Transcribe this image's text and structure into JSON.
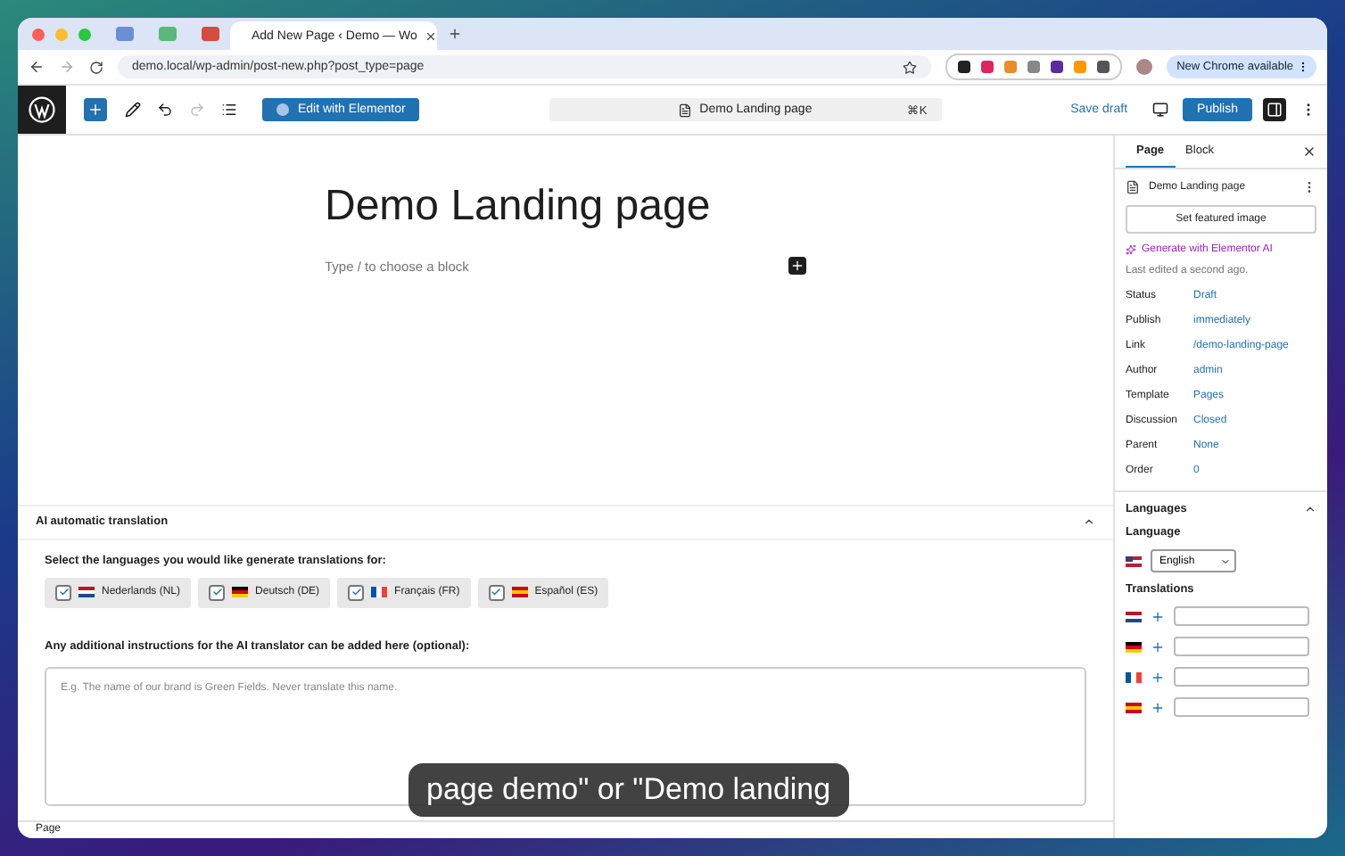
{
  "browser": {
    "tab_title": "Add New Page ‹ Demo — Wo",
    "url": "demo.local/wp-admin/post-new.php?post_type=page",
    "update_button": "New Chrome available"
  },
  "toolbar": {
    "elementor_button": "Edit with Elementor",
    "command_title": "Demo Landing page",
    "shortcut": "⌘K",
    "save_draft": "Save draft",
    "publish": "Publish"
  },
  "editor": {
    "title": "Demo Landing page",
    "placeholder": "Type / to choose a block"
  },
  "sidebar": {
    "tabs": [
      {
        "label": "Page",
        "selected": true
      },
      {
        "label": "Block",
        "selected": false
      }
    ],
    "page_title": "Demo Landing page",
    "featured_button": "Set featured image",
    "ai_link": "Generate with Elementor AI",
    "last_edited": "Last edited a second ago.",
    "fields": [
      {
        "label": "Status",
        "value": "Draft"
      },
      {
        "label": "Publish",
        "value": "immediately"
      },
      {
        "label": "Link",
        "value": "/demo-landing-page"
      },
      {
        "label": "Author",
        "value": "admin"
      },
      {
        "label": "Template",
        "value": "Pages"
      },
      {
        "label": "Discussion",
        "value": "Closed"
      },
      {
        "label": "Parent",
        "value": "None"
      },
      {
        "label": "Order",
        "value": "0"
      }
    ],
    "languages": {
      "title": "Languages",
      "expanded": true,
      "language_label": "Language",
      "language": {
        "kind": "us",
        "label": "English"
      },
      "translations_label": "Translations",
      "translations": [
        {
          "kind": "nl"
        },
        {
          "kind": "de"
        },
        {
          "kind": "fr"
        },
        {
          "kind": "es"
        }
      ]
    }
  },
  "metabox": {
    "title": "AI automatic translation",
    "expanded": true,
    "prompt": "Select the languages you would like generate translations for:",
    "languages": [
      {
        "label": "Nederlands (NL)",
        "kind": "nl",
        "checked": true
      },
      {
        "label": "Deutsch (DE)",
        "kind": "de",
        "checked": true
      },
      {
        "label": "Français (FR)",
        "kind": "fr",
        "checked": true
      },
      {
        "label": "Español (ES)",
        "kind": "es",
        "checked": true
      }
    ],
    "instructions_label": "Any additional instructions for the AI translator can be added here (optional):",
    "instructions_placeholder": "E.g. The name of our brand is Green Fields. Never translate this name."
  },
  "status_bar": "Page",
  "subtitle": "page demo\" or \"Demo landing"
}
